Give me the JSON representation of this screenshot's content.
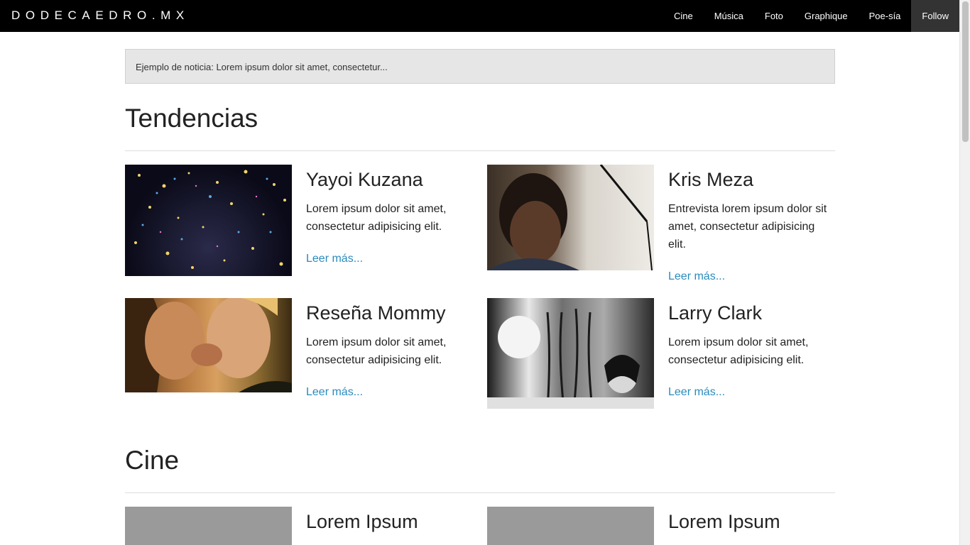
{
  "site": {
    "brand": "DODECAEDRO.MX"
  },
  "nav": {
    "items": [
      {
        "label": "Cine"
      },
      {
        "label": "Música"
      },
      {
        "label": "Foto"
      },
      {
        "label": "Graphique"
      },
      {
        "label": "Poe-sía"
      },
      {
        "label": "Follow",
        "active": true
      }
    ]
  },
  "notice": {
    "text": "Ejemplo de noticia: Lorem ipsum dolor sit amet, consectetur..."
  },
  "sections": [
    {
      "title": "Tendencias",
      "articles": [
        {
          "title": "Yayoi Kuzana",
          "description": "Lorem ipsum dolor sit amet, consectetur adipisicing elit.",
          "link": "Leer más...",
          "image": "infinity-lights-room"
        },
        {
          "title": "Kris Meza",
          "description": "Entrevista lorem ipsum dolor sit amet, consectetur adipisicing elit.",
          "link": "Leer más...",
          "image": "portrait-man-microphone"
        },
        {
          "title": "Reseña Mommy",
          "description": "Lorem ipsum dolor sit amet, consectetur adipisicing elit.",
          "link": "Leer más...",
          "image": "film-still-kiss"
        },
        {
          "title": "Larry Clark",
          "description": "Lorem ipsum dolor sit amet, consectetur adipisicing elit.",
          "link": "Leer más...",
          "image": "black-and-white-photo"
        }
      ]
    },
    {
      "title": "Cine",
      "articles": [
        {
          "title": "Lorem Ipsum",
          "image": "gray-placeholder"
        },
        {
          "title": "Lorem Ipsum",
          "image": "gray-placeholder"
        }
      ]
    }
  ],
  "colors": {
    "topbar": "#000000",
    "active_nav": "#333333",
    "link": "#2a8bbd",
    "notice_bg": "#e6e6e6"
  }
}
